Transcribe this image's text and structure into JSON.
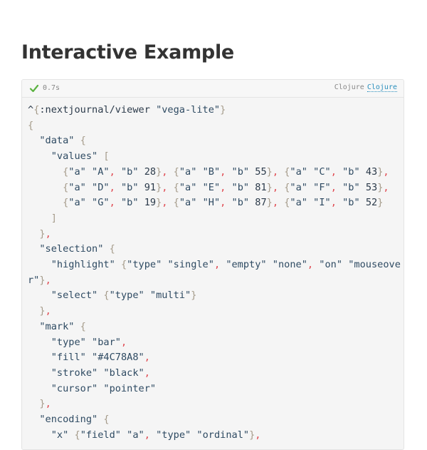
{
  "page": {
    "title": "Interactive Example"
  },
  "cell": {
    "status_icon": "check-icon",
    "status_color": "#5bb240",
    "duration": "0.7s",
    "language": "Clojure",
    "language_link": "Clojure"
  },
  "code": {
    "language": "clojure",
    "lines": [
      "^{:nextjournal/viewer \"vega-lite\"}",
      "{",
      "  \"data\" {",
      "    \"values\" [",
      "      {\"a\" \"A\", \"b\" 28}, {\"a\" \"B\", \"b\" 55}, {\"a\" \"C\", \"b\" 43},",
      "      {\"a\" \"D\", \"b\" 91}, {\"a\" \"E\", \"b\" 81}, {\"a\" \"F\", \"b\" 53},",
      "      {\"a\" \"G\", \"b\" 19}, {\"a\" \"H\", \"b\" 87}, {\"a\" \"I\", \"b\" 52}",
      "    ]",
      "  },",
      "  \"selection\" {",
      "    \"highlight\" {\"type\" \"single\", \"empty\" \"none\", \"on\" \"mouseover\"},",
      "    \"select\" {\"type\" \"multi\"}",
      "  },",
      "  \"mark\" {",
      "    \"type\" \"bar\",",
      "    \"fill\" \"#4C78A8\",",
      "    \"stroke\" \"black\",",
      "    \"cursor\" \"pointer\"",
      "  },",
      "  \"encoding\" {",
      "    \"x\" {\"field\" \"a\", \"type\" \"ordinal\"},"
    ]
  }
}
